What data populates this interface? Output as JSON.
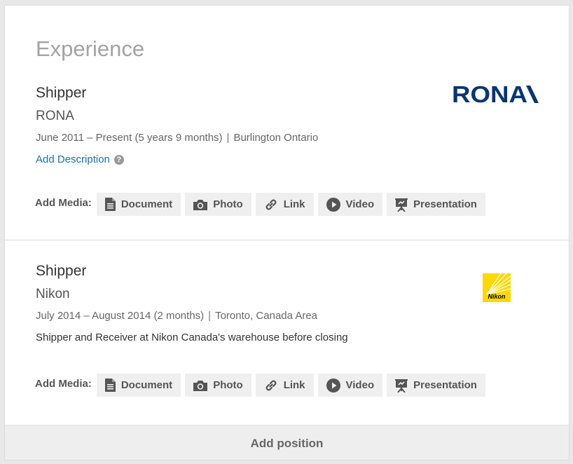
{
  "section": {
    "title": "Experience"
  },
  "positions": [
    {
      "title": "Shipper",
      "company": "RONA",
      "dates": "June 2011 – Present (5 years 9 months)",
      "separator": "|",
      "location": "Burlington Ontario",
      "add_description": "Add Description",
      "help": "?",
      "logo_text": "RONA",
      "media_label": "Add Media:",
      "media_buttons": [
        "Document",
        "Photo",
        "Link",
        "Video",
        "Presentation"
      ]
    },
    {
      "title": "Shipper",
      "company": "Nikon",
      "dates": "July 2014 – August 2014 (2 months)",
      "separator": "|",
      "location": "Toronto, Canada Area",
      "description": "Shipper and Receiver at Nikon Canada's warehouse before closing",
      "logo_text": "Nikon",
      "media_label": "Add Media:",
      "media_buttons": [
        "Document",
        "Photo",
        "Link",
        "Video",
        "Presentation"
      ]
    }
  ],
  "footer": {
    "add_position": "Add position"
  },
  "icons": {
    "document": "document-icon",
    "photo": "camera-icon",
    "link": "link-icon",
    "video": "play-icon",
    "presentation": "presentation-icon"
  },
  "colors": {
    "link": "#1a73b0",
    "rona_brand": "#0a3570",
    "nikon_brand": "#ffd800"
  }
}
